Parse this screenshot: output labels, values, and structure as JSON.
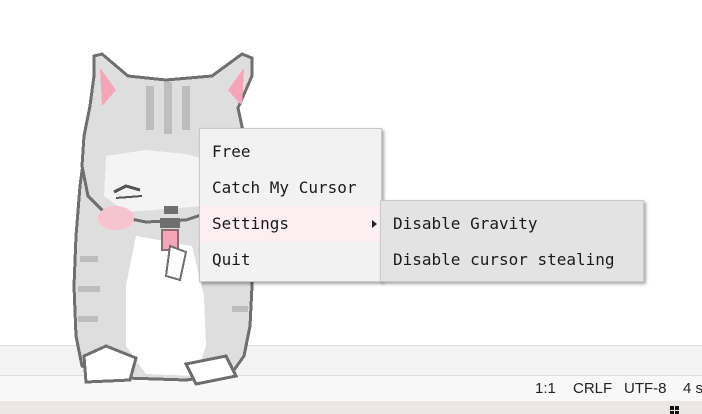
{
  "context_menu": {
    "items": [
      {
        "label": "Free"
      },
      {
        "label": "Catch My Cursor"
      },
      {
        "label": "Settings",
        "has_submenu": true
      },
      {
        "label": "Quit"
      }
    ],
    "highlighted_item": "Settings"
  },
  "settings_submenu": {
    "items": [
      {
        "label": "Disable Gravity"
      },
      {
        "label": "Disable cursor stealing"
      }
    ]
  },
  "status_bar": {
    "cursor_position": "1:1",
    "line_ending": "CRLF",
    "encoding": "UTF-8",
    "indentation": "4 s"
  },
  "desktop_pet": {
    "sprite": "pixel-art-grey-tabby-cat-licking-paw"
  },
  "colors": {
    "menu_background": "#f2f2f2",
    "submenu_background": "#e3e3e3",
    "highlight": "#fdeef2",
    "cat_fur": "#dcdcdc",
    "cat_stripes": "#bdbdbd",
    "cat_outline": "#6f6f6f",
    "cat_blush": "#f7c3cf"
  }
}
